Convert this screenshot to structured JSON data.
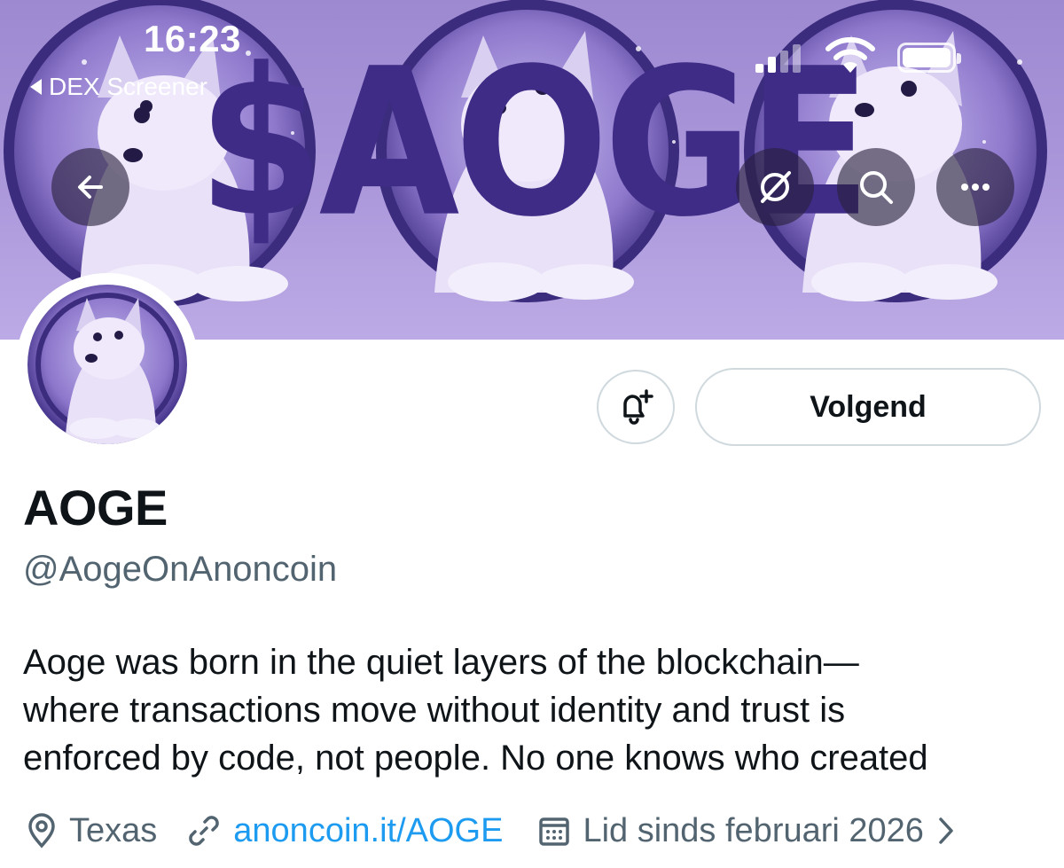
{
  "status_bar": {
    "time": "16:23",
    "back_app_label": "DEX Screener"
  },
  "banner": {
    "ticker_text": "$AOGE",
    "buttons": {
      "back": "arrow-left-icon",
      "grok": "grok-icon",
      "search": "search-icon",
      "more": "more-icon"
    }
  },
  "actions": {
    "notification_icon": "bell-plus-icon",
    "follow_label": "Volgend"
  },
  "profile": {
    "display_name": "AOGE",
    "handle": "@AogeOnAnoncoin",
    "bio_lines": [
      "Aoge was born in the quiet layers of the blockchain—",
      "where transactions move without identity and trust is",
      "enforced by code, not people. No one knows who created"
    ]
  },
  "meta": {
    "location": "Texas",
    "website": "anoncoin.it/AOGE",
    "joined": "Lid sinds februari 2026"
  },
  "colors": {
    "banner": "#a894d8",
    "ticker": "#3e2c86",
    "link": "#1d9bf0",
    "secondary_text": "#536471"
  }
}
